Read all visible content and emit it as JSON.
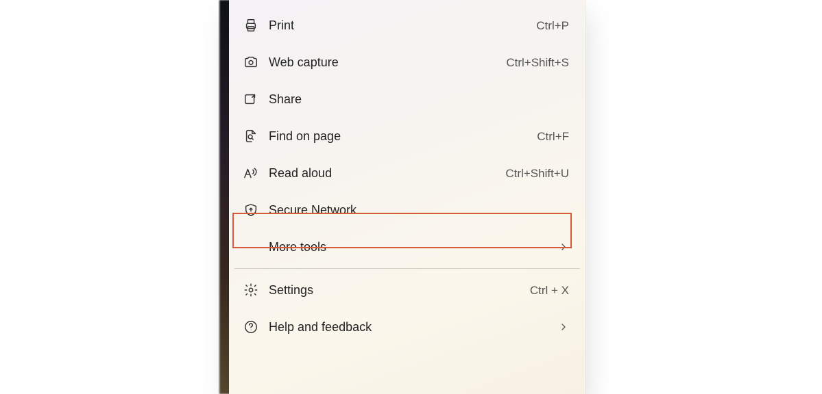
{
  "menu": {
    "print": {
      "label": "Print",
      "shortcut": "Ctrl+P"
    },
    "webcapture": {
      "label": "Web capture",
      "shortcut": "Ctrl+Shift+S"
    },
    "share": {
      "label": "Share",
      "shortcut": ""
    },
    "find": {
      "label": "Find on page",
      "shortcut": "Ctrl+F"
    },
    "readaloud": {
      "label": "Read aloud",
      "shortcut": "Ctrl+Shift+U"
    },
    "securenetwork": {
      "label": "Secure Network",
      "shortcut": ""
    },
    "moretools": {
      "label": "More tools"
    },
    "settings": {
      "label": "Settings",
      "shortcut": "Ctrl + X"
    },
    "help": {
      "label": "Help and feedback"
    }
  }
}
